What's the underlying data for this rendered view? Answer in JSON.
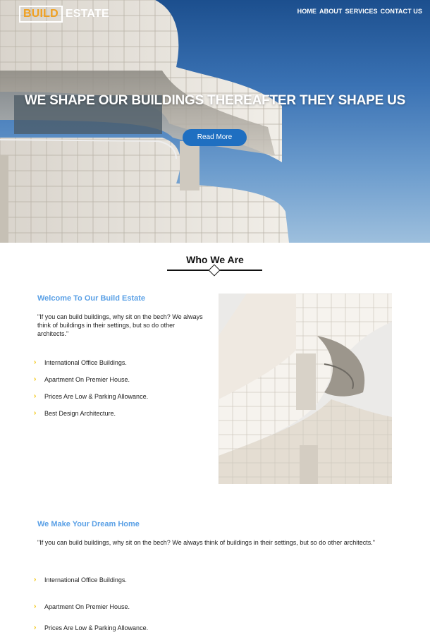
{
  "brand": {
    "logo_boxed": "BUILD",
    "logo_rest": "ESTATE"
  },
  "nav": [
    "HOME",
    "ABOUT",
    "SERVICES",
    "CONTACT US"
  ],
  "hero": {
    "title": "WE SHAPE OUR BUILDINGS THEREAFTER THEY SHAPE US",
    "button": "Read More"
  },
  "about": {
    "title": "Who We Are",
    "welcome": {
      "heading": "Welcome To Our Build Estate",
      "quote": "\"If you can build buildings, why sit on the bech? We always think of buildings in their settings, but so do other architects.\"",
      "items": [
        "International Office Buildings.",
        "Apartment On Premier House.",
        "Prices Are Low & Parking Allowance.",
        "Best Design Architecture."
      ]
    },
    "dream": {
      "heading": "We Make Your Dream Home",
      "quote": "\"If you can build buildings, why sit on the bech? We always think of buildings in their settings, but so do other architects.\"",
      "items": [
        "International Office Buildings.",
        "Apartment On Premier House.",
        "Prices Are Low & Parking Allowance."
      ]
    }
  },
  "colors": {
    "accent_blue": "#1f6fc1",
    "subhead_blue": "#5aa0e6",
    "logo_orange": "#f0a020",
    "chevron_yellow": "#f2c200"
  },
  "icons": {
    "bullet": "chevron-right-icon"
  }
}
